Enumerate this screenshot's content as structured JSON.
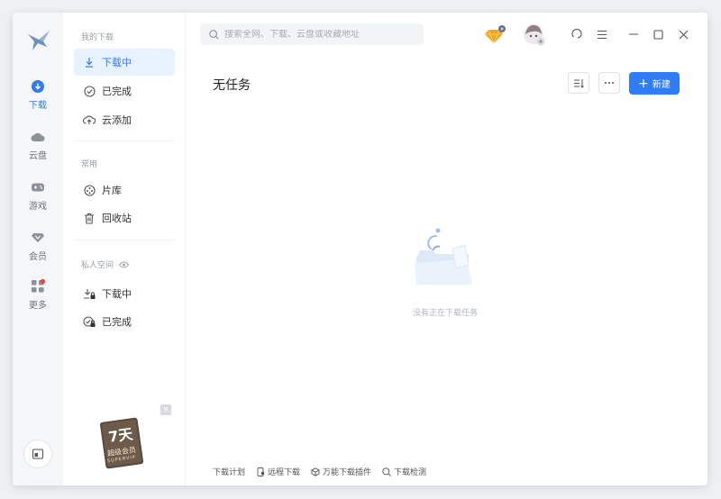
{
  "rail": {
    "items": [
      {
        "label": "下载",
        "icon": "download-circle-icon"
      },
      {
        "label": "云盘",
        "icon": "cloud-icon"
      },
      {
        "label": "游戏",
        "icon": "gamepad-icon"
      },
      {
        "label": "会员",
        "icon": "diamond-icon"
      },
      {
        "label": "更多",
        "icon": "grid-icon"
      }
    ],
    "accent": "#2f7cf6"
  },
  "sidebar": {
    "my_downloads_title": "我的下载",
    "items": [
      {
        "label": "下载中",
        "icon": "download-arrow-icon"
      },
      {
        "label": "已完成",
        "icon": "check-circle-icon"
      },
      {
        "label": "云添加",
        "icon": "cloud-upload-icon"
      }
    ],
    "common_title": "常用",
    "common_items": [
      {
        "label": "片库",
        "icon": "film-reel-icon"
      },
      {
        "label": "回收站",
        "icon": "trash-icon"
      }
    ],
    "private_title": "私人空间",
    "private_items": [
      {
        "label": "下载中",
        "icon": "locked-download-icon"
      },
      {
        "label": "已完成",
        "icon": "locked-check-icon"
      }
    ],
    "promo": {
      "days": "7天",
      "line1": "超级会员",
      "line2": "SUPERVIP"
    }
  },
  "header": {
    "search_placeholder": "搜索全网、下载、云盘或收藏地址"
  },
  "main": {
    "title": "无任务",
    "new_button": "新建",
    "empty_text": "没有正在下载任务"
  },
  "footer": {
    "links": [
      {
        "label": "下载计划"
      },
      {
        "label": "远程下载"
      },
      {
        "label": "万能下载插件"
      },
      {
        "label": "下载检测"
      }
    ]
  }
}
